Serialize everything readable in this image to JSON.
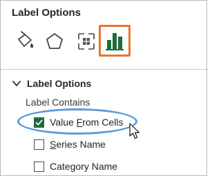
{
  "pane": {
    "title": "Label Options"
  },
  "tabs": [
    {
      "icon": "fill-line-icon",
      "selected": false
    },
    {
      "icon": "effects-pentagon-icon",
      "selected": false
    },
    {
      "icon": "size-properties-icon",
      "selected": false
    },
    {
      "icon": "label-options-chart-icon",
      "selected": true
    }
  ],
  "section": {
    "title": "Label Options",
    "expanded": true,
    "subheader": "Label Contains",
    "options": [
      {
        "pre": "Value ",
        "u": "F",
        "post": "rom Cells",
        "checked": true
      },
      {
        "pre": "",
        "u": "S",
        "post": "eries Name",
        "checked": false
      },
      {
        "pre": "Cate",
        "u": "g",
        "post": "ory Name",
        "checked": false
      }
    ]
  },
  "colors": {
    "active_tab_border": "#e8732b",
    "chart_icon_green": "#1f6b3a",
    "checkbox_checked": "#1f6b3a",
    "annotation_ellipse": "#5b9bd5"
  }
}
